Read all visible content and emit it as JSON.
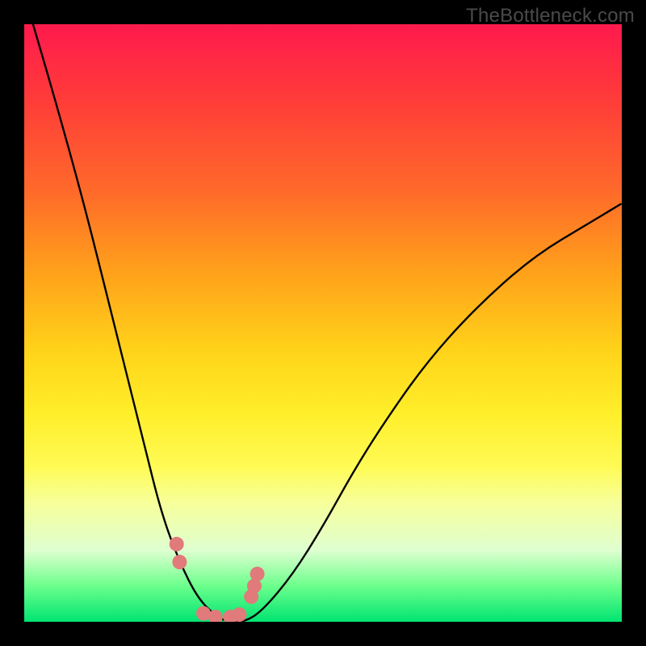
{
  "watermark": "TheBottleneck.com",
  "chart_data": {
    "type": "line",
    "title": "",
    "xlabel": "",
    "ylabel": "",
    "ylim": [
      0,
      100
    ],
    "series": [
      {
        "name": "bottleneck-curve",
        "x": [
          0.0,
          0.05,
          0.1,
          0.15,
          0.2,
          0.23,
          0.26,
          0.29,
          0.32,
          0.34,
          0.37,
          0.4,
          0.45,
          0.5,
          0.55,
          0.6,
          0.67,
          0.75,
          0.85,
          0.95,
          1.0
        ],
        "values": [
          105,
          88,
          70,
          50,
          30,
          18,
          10,
          4,
          1,
          0,
          0,
          2,
          8,
          16,
          25,
          33,
          43,
          52,
          61,
          67,
          70
        ]
      }
    ],
    "markers": {
      "name": "highlight-dots",
      "color": "#e17a7a",
      "points_x": [
        0.255,
        0.26,
        0.3,
        0.32,
        0.345,
        0.36,
        0.38,
        0.385,
        0.39
      ],
      "points_y": [
        13,
        10,
        1.4,
        0.8,
        0.8,
        1.2,
        4.2,
        6.0,
        8.0
      ]
    },
    "gradient_stops": [
      {
        "pos": 0.0,
        "color": "#ff1a4d"
      },
      {
        "pos": 0.55,
        "color": "#ffd41a"
      },
      {
        "pos": 0.8,
        "color": "#f7ff9a"
      },
      {
        "pos": 1.0,
        "color": "#00e472"
      }
    ]
  }
}
